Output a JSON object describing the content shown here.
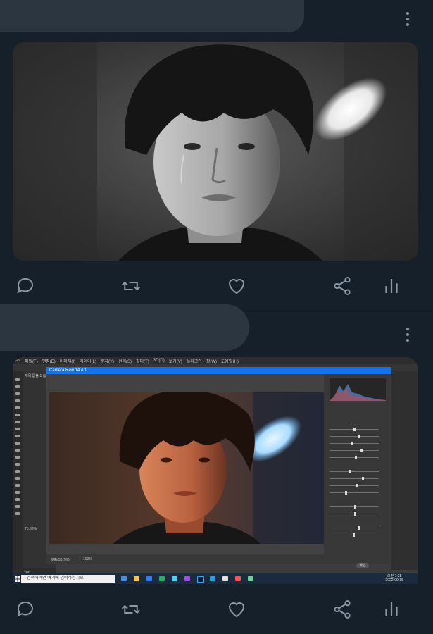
{
  "posts": [
    {
      "actions": {
        "reply": "reply-icon",
        "retweet": "retweet-icon",
        "like": "heart-icon",
        "share": "share-icon",
        "analytics": "analytics-icon"
      }
    },
    {
      "actions": {
        "reply": "reply-icon",
        "retweet": "retweet-icon",
        "like": "heart-icon",
        "share": "share-icon",
        "analytics": "analytics-icon"
      },
      "photoshop": {
        "menu": [
          "파일(F)",
          "편집(E)",
          "이미지(I)",
          "레이어(L)",
          "문자(Y)",
          "선택(S)",
          "필터(T)",
          "3D(D)",
          "보기(V)",
          "플러그인",
          "창(W)",
          "도움말(H)"
        ],
        "camera_raw_title": "Camera Raw 14.4.1",
        "left_tab": "제목 없음-1 @ 66.7%",
        "zoom": "75.33%",
        "bottom_zoom": "100%",
        "bottom_mode": "맞춤(58.7%)",
        "status_tab": "저장",
        "ok_button": "확인"
      },
      "taskbar": {
        "search_placeholder": "검색하려면 여기에 입력하십시오",
        "time": "오전 7:38",
        "date": "2022-09-15"
      }
    }
  ],
  "colors": {
    "background": "#15202b",
    "icon": "#8b98a5",
    "accent": "#1473e6"
  }
}
